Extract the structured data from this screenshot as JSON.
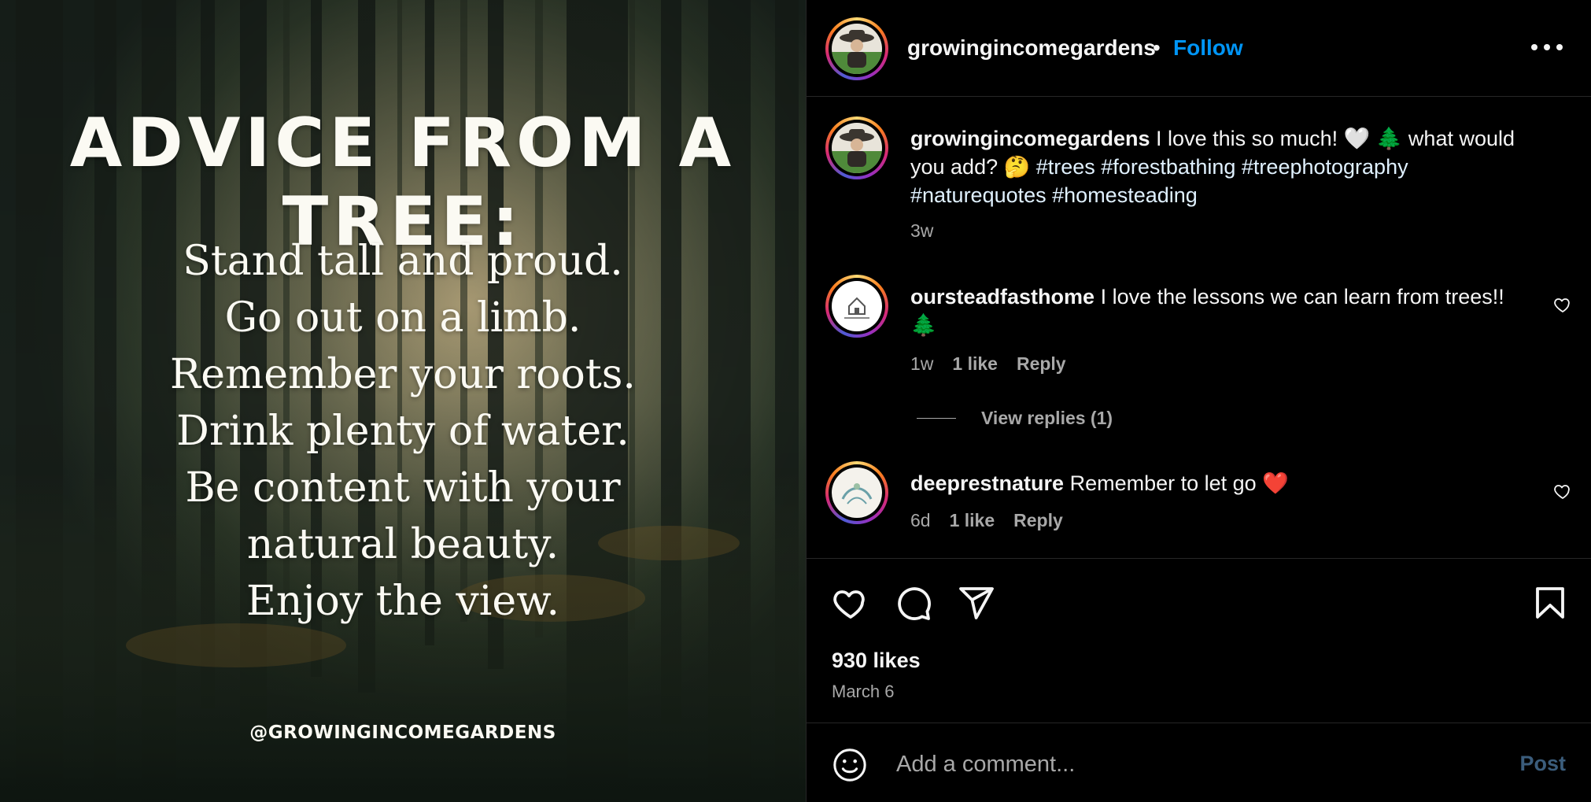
{
  "image": {
    "title": "ADVICE FROM A TREE:",
    "lines": [
      "Stand tall and proud.",
      "Go out on a limb.",
      "Remember your roots.",
      "Drink plenty of water.",
      "Be content with your",
      "natural beauty.",
      "Enjoy the view."
    ],
    "handle": "@GROWINGINCOMEGARDENS"
  },
  "header": {
    "username": "growingincomegardens",
    "separator": "•",
    "follow_label": "Follow",
    "more_icon": "more-horizontal-icon"
  },
  "caption": {
    "username": "growingincomegardens",
    "text_before": " I love this so much! ",
    "emoji_heart": "🤍",
    "emoji_tree": "🌲",
    "text_mid": " what would you add? ",
    "emoji_think": "🤔",
    "hashtags": "#trees #forestbathing #treephotography #naturequotes #homesteading",
    "time": "3w"
  },
  "comments": [
    {
      "username": "oursteadfasthome",
      "text": " I love the lessons we can learn from trees!! 🌲",
      "time": "1w",
      "likes": "1 like",
      "reply": "Reply",
      "view_replies": "View replies (1)"
    },
    {
      "username": "deeprestnature",
      "text": " Remember to let go ❤️",
      "time": "6d",
      "likes": "1 like",
      "reply": "Reply"
    }
  ],
  "actions": {
    "like_icon": "heart-icon",
    "comment_icon": "comment-icon",
    "share_icon": "share-icon",
    "save_icon": "bookmark-icon",
    "likes": "930 likes",
    "date": "March 6"
  },
  "composer": {
    "placeholder": "Add a comment...",
    "post_label": "Post",
    "emoji_icon": "emoji-icon"
  },
  "colors": {
    "background": "#000000",
    "link_blue": "#0095f6",
    "muted": "#a8a8a8",
    "post_disabled": "#3b5d7c"
  }
}
